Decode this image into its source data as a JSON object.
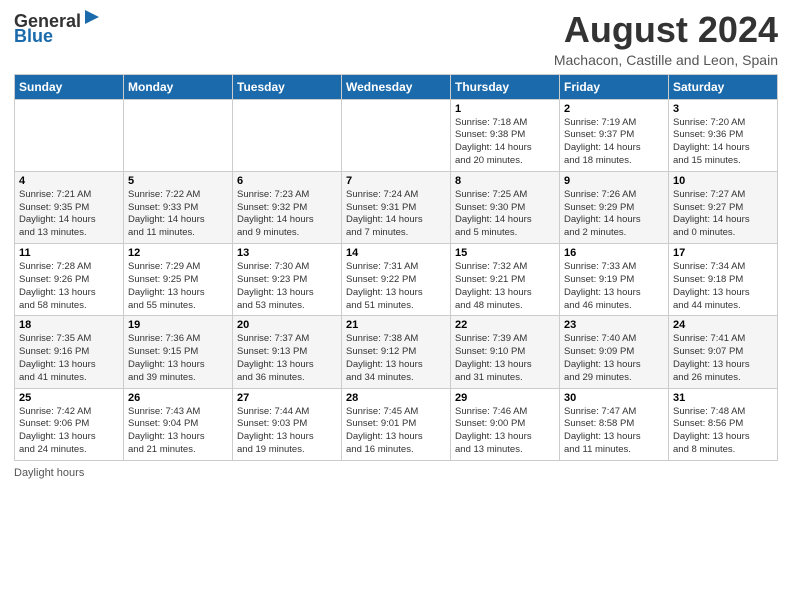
{
  "header": {
    "logo_general": "General",
    "logo_blue": "Blue",
    "main_title": "August 2024",
    "subtitle": "Machacon, Castille and Leon, Spain"
  },
  "calendar": {
    "days_of_week": [
      "Sunday",
      "Monday",
      "Tuesday",
      "Wednesday",
      "Thursday",
      "Friday",
      "Saturday"
    ],
    "weeks": [
      [
        {
          "day": "",
          "info": ""
        },
        {
          "day": "",
          "info": ""
        },
        {
          "day": "",
          "info": ""
        },
        {
          "day": "",
          "info": ""
        },
        {
          "day": "1",
          "info": "Sunrise: 7:18 AM\nSunset: 9:38 PM\nDaylight: 14 hours\nand 20 minutes."
        },
        {
          "day": "2",
          "info": "Sunrise: 7:19 AM\nSunset: 9:37 PM\nDaylight: 14 hours\nand 18 minutes."
        },
        {
          "day": "3",
          "info": "Sunrise: 7:20 AM\nSunset: 9:36 PM\nDaylight: 14 hours\nand 15 minutes."
        }
      ],
      [
        {
          "day": "4",
          "info": "Sunrise: 7:21 AM\nSunset: 9:35 PM\nDaylight: 14 hours\nand 13 minutes."
        },
        {
          "day": "5",
          "info": "Sunrise: 7:22 AM\nSunset: 9:33 PM\nDaylight: 14 hours\nand 11 minutes."
        },
        {
          "day": "6",
          "info": "Sunrise: 7:23 AM\nSunset: 9:32 PM\nDaylight: 14 hours\nand 9 minutes."
        },
        {
          "day": "7",
          "info": "Sunrise: 7:24 AM\nSunset: 9:31 PM\nDaylight: 14 hours\nand 7 minutes."
        },
        {
          "day": "8",
          "info": "Sunrise: 7:25 AM\nSunset: 9:30 PM\nDaylight: 14 hours\nand 5 minutes."
        },
        {
          "day": "9",
          "info": "Sunrise: 7:26 AM\nSunset: 9:29 PM\nDaylight: 14 hours\nand 2 minutes."
        },
        {
          "day": "10",
          "info": "Sunrise: 7:27 AM\nSunset: 9:27 PM\nDaylight: 14 hours\nand 0 minutes."
        }
      ],
      [
        {
          "day": "11",
          "info": "Sunrise: 7:28 AM\nSunset: 9:26 PM\nDaylight: 13 hours\nand 58 minutes."
        },
        {
          "day": "12",
          "info": "Sunrise: 7:29 AM\nSunset: 9:25 PM\nDaylight: 13 hours\nand 55 minutes."
        },
        {
          "day": "13",
          "info": "Sunrise: 7:30 AM\nSunset: 9:23 PM\nDaylight: 13 hours\nand 53 minutes."
        },
        {
          "day": "14",
          "info": "Sunrise: 7:31 AM\nSunset: 9:22 PM\nDaylight: 13 hours\nand 51 minutes."
        },
        {
          "day": "15",
          "info": "Sunrise: 7:32 AM\nSunset: 9:21 PM\nDaylight: 13 hours\nand 48 minutes."
        },
        {
          "day": "16",
          "info": "Sunrise: 7:33 AM\nSunset: 9:19 PM\nDaylight: 13 hours\nand 46 minutes."
        },
        {
          "day": "17",
          "info": "Sunrise: 7:34 AM\nSunset: 9:18 PM\nDaylight: 13 hours\nand 44 minutes."
        }
      ],
      [
        {
          "day": "18",
          "info": "Sunrise: 7:35 AM\nSunset: 9:16 PM\nDaylight: 13 hours\nand 41 minutes."
        },
        {
          "day": "19",
          "info": "Sunrise: 7:36 AM\nSunset: 9:15 PM\nDaylight: 13 hours\nand 39 minutes."
        },
        {
          "day": "20",
          "info": "Sunrise: 7:37 AM\nSunset: 9:13 PM\nDaylight: 13 hours\nand 36 minutes."
        },
        {
          "day": "21",
          "info": "Sunrise: 7:38 AM\nSunset: 9:12 PM\nDaylight: 13 hours\nand 34 minutes."
        },
        {
          "day": "22",
          "info": "Sunrise: 7:39 AM\nSunset: 9:10 PM\nDaylight: 13 hours\nand 31 minutes."
        },
        {
          "day": "23",
          "info": "Sunrise: 7:40 AM\nSunset: 9:09 PM\nDaylight: 13 hours\nand 29 minutes."
        },
        {
          "day": "24",
          "info": "Sunrise: 7:41 AM\nSunset: 9:07 PM\nDaylight: 13 hours\nand 26 minutes."
        }
      ],
      [
        {
          "day": "25",
          "info": "Sunrise: 7:42 AM\nSunset: 9:06 PM\nDaylight: 13 hours\nand 24 minutes."
        },
        {
          "day": "26",
          "info": "Sunrise: 7:43 AM\nSunset: 9:04 PM\nDaylight: 13 hours\nand 21 minutes."
        },
        {
          "day": "27",
          "info": "Sunrise: 7:44 AM\nSunset: 9:03 PM\nDaylight: 13 hours\nand 19 minutes."
        },
        {
          "day": "28",
          "info": "Sunrise: 7:45 AM\nSunset: 9:01 PM\nDaylight: 13 hours\nand 16 minutes."
        },
        {
          "day": "29",
          "info": "Sunrise: 7:46 AM\nSunset: 9:00 PM\nDaylight: 13 hours\nand 13 minutes."
        },
        {
          "day": "30",
          "info": "Sunrise: 7:47 AM\nSunset: 8:58 PM\nDaylight: 13 hours\nand 11 minutes."
        },
        {
          "day": "31",
          "info": "Sunrise: 7:48 AM\nSunset: 8:56 PM\nDaylight: 13 hours\nand 8 minutes."
        }
      ]
    ]
  },
  "footer": {
    "text": "Daylight hours"
  }
}
